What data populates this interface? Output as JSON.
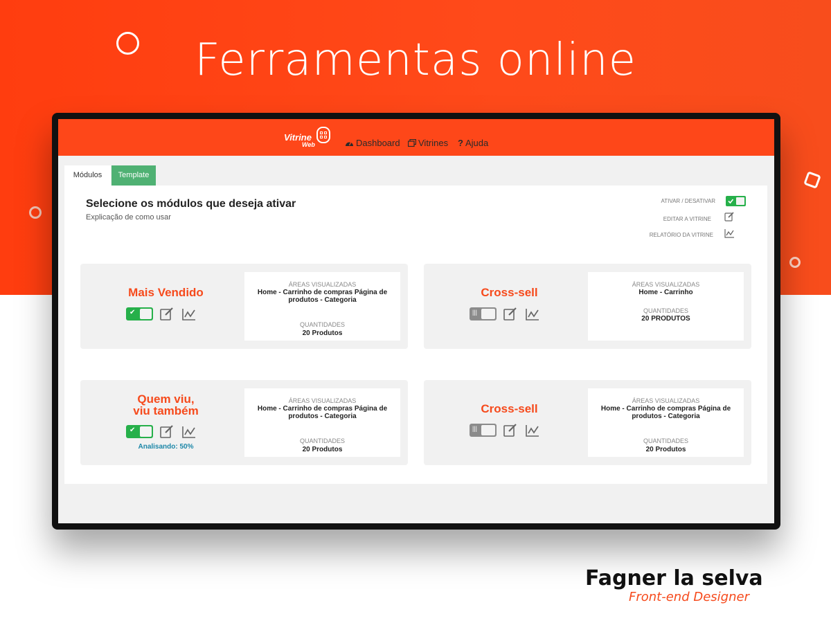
{
  "hero": {
    "title": "Ferramentas online"
  },
  "app": {
    "logo": {
      "main": "Vitrine",
      "sub": "Web"
    },
    "nav": [
      {
        "label": "Dashboard",
        "icon": "dashboard-icon"
      },
      {
        "label": "Vitrines",
        "icon": "vitrines-icon"
      },
      {
        "label": "Ajuda",
        "icon": "help-icon"
      }
    ],
    "tabs": [
      {
        "label": "Módulos",
        "active": true
      },
      {
        "label": "Template",
        "active": false
      }
    ],
    "panel": {
      "title": "Selecione os módulos que deseja ativar",
      "subtitle": "Explicação de como usar",
      "legend": {
        "toggle": "ATIVAR / DESATIVAR",
        "edit": "EDITAR A VITRINE",
        "report": "RELATÓRIO DA VITRINE"
      }
    },
    "cards": [
      {
        "name": "Mais Vendido",
        "active": true,
        "areas_label": "ÁREAS VISUALIZADAS",
        "areas": "Home - Carrinho de compras Página de produtos - Categoria",
        "qty_label": "QUANTIDADES",
        "qty": "20 Produtos"
      },
      {
        "name": "Cross-sell",
        "active": false,
        "areas_label": "ÁREAS VISUALIZADAS",
        "areas": "Home - Carrinho",
        "qty_label": "QUANTIDADES",
        "qty": "20 PRODUTOS"
      },
      {
        "name_line1": "Quem viu,",
        "name_line2": "viu também",
        "active": true,
        "status": "Analisando: 50%",
        "areas_label": "ÁREAS VISUALIZADAS",
        "areas": "Home - Carrinho de compras Página de produtos - Categoria",
        "qty_label": "QUANTIDADES",
        "qty": "20 Produtos"
      },
      {
        "name": "Cross-sell",
        "active": false,
        "areas_label": "ÁREAS VISUALIZADAS",
        "areas": "Home - Carrinho de compras Página de produtos - Categoria",
        "qty_label": "QUANTIDADES",
        "qty": "20 Produtos"
      }
    ]
  },
  "credit": {
    "name": "Fagner la selva",
    "role": "Front-end Designer"
  },
  "colors": {
    "brand": "#fe4719",
    "toggle_on": "#26b04a",
    "toggle_off": "#8b8b8b",
    "tab_template": "#4fb173",
    "status": "#1d87a8"
  }
}
